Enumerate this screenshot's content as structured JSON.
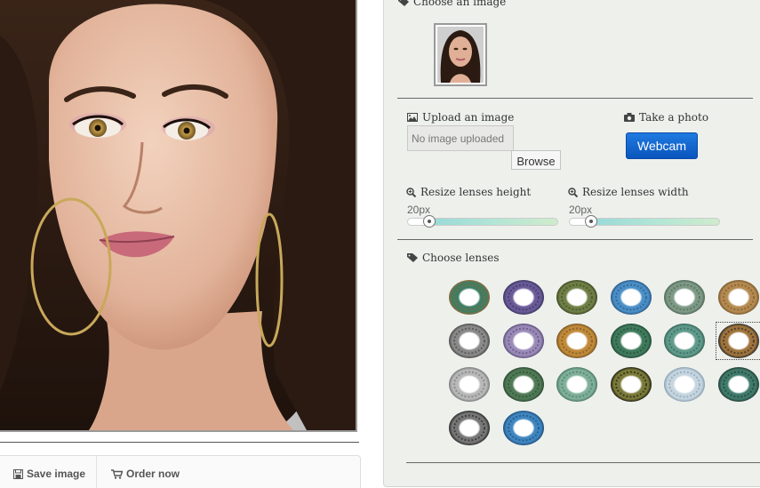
{
  "photo": {
    "subject": "portrait photo"
  },
  "actions": {
    "save_label": "Save image",
    "order_label": "Order now"
  },
  "panel": {
    "choose_image_label": "Choose an image",
    "upload_label": "Upload an image",
    "upload_placeholder": "No image uploaded",
    "browse_label": "Browse",
    "take_photo_label": "Take a photo",
    "webcam_label": "Webcam",
    "resize_height_label": "Resize lenses height",
    "resize_width_label": "Resize lenses width",
    "height_value": "20px",
    "width_value": "20px",
    "choose_lenses_label": "Choose lenses"
  },
  "lenses": [
    {
      "color": "#3f7d63",
      "accent": "#8a6a3a"
    },
    {
      "color": "#6a5a98",
      "accent": "#3b3660"
    },
    {
      "color": "#6f7f45",
      "accent": "#3e4a26"
    },
    {
      "color": "#4b8fc7",
      "accent": "#2a5a88"
    },
    {
      "color": "#7e9a86",
      "accent": "#4f6a58"
    },
    {
      "color": "#b58a50",
      "accent": "#7a5a30"
    },
    {
      "color": "#8a8a8a",
      "accent": "#4a4a4a"
    },
    {
      "color": "#9a8ab8",
      "accent": "#5c4f7c"
    },
    {
      "color": "#c08a3a",
      "accent": "#7a5520"
    },
    {
      "color": "#3f7b5c",
      "accent": "#234a36"
    },
    {
      "color": "#5f9a8a",
      "accent": "#35665a"
    },
    {
      "color": "#a0743c",
      "accent": "#2a2a2a"
    },
    {
      "color": "#b8b8b8",
      "accent": "#7a7a7a"
    },
    {
      "color": "#4f7a55",
      "accent": "#2e4a33"
    },
    {
      "color": "#7fb09a",
      "accent": "#4e7a66"
    },
    {
      "color": "#7a7a3a",
      "accent": "#1f1f10"
    },
    {
      "color": "#c6d6e0",
      "accent": "#8aa0b0"
    },
    {
      "color": "#3f7a6a",
      "accent": "#233f36"
    },
    {
      "color": "#777777",
      "accent": "#2a2a2a"
    },
    {
      "color": "#3f86c0",
      "accent": "#1e4e7a"
    }
  ],
  "selected_lens": 11,
  "colors": {
    "panel_bg": "#eef0ec",
    "webcam_button": "#0a55bd"
  }
}
